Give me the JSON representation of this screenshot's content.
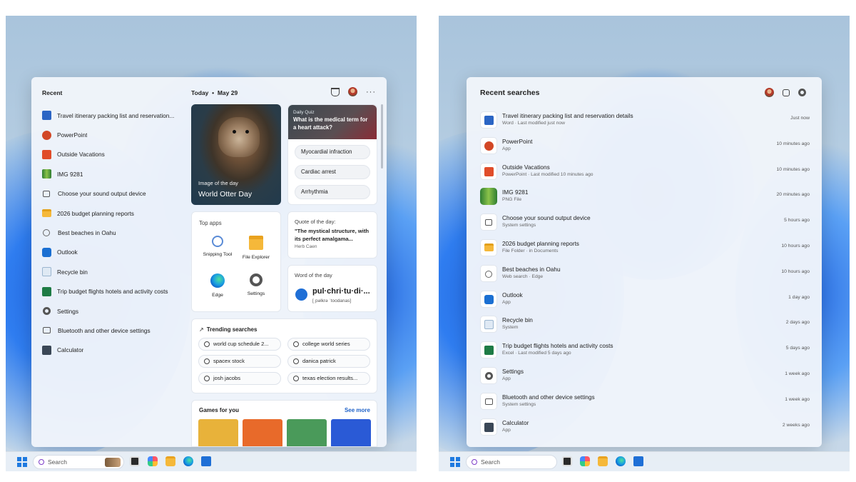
{
  "left": {
    "recent_title": "Recent",
    "recent": [
      {
        "label": "Travel itinerary packing list and reservation...",
        "icon": "word-icon"
      },
      {
        "label": "PowerPoint",
        "icon": "powerpoint-icon"
      },
      {
        "label": "Outside Vacations",
        "icon": "powerpoint-file-icon"
      },
      {
        "label": "IMG 9281",
        "icon": "image-icon"
      },
      {
        "label": "Choose your sound output device",
        "icon": "speaker-icon"
      },
      {
        "label": "2026 budget planning reports",
        "icon": "folder-icon"
      },
      {
        "label": "Best beaches in Oahu",
        "icon": "search-icon"
      },
      {
        "label": "Outlook",
        "icon": "outlook-icon"
      },
      {
        "label": "Recycle bin",
        "icon": "recycle-bin-icon"
      },
      {
        "label": "Trip budget flights hotels and activity costs",
        "icon": "excel-icon"
      },
      {
        "label": "Settings",
        "icon": "gear-icon"
      },
      {
        "label": "Bluetooth and other device settings",
        "icon": "bluetooth-icon"
      },
      {
        "label": "Calculator",
        "icon": "calculator-icon"
      }
    ],
    "today_label": "Today",
    "date": "May 29",
    "image_card": {
      "caption": "Image of the day",
      "title": "World Otter Day"
    },
    "quiz": {
      "kicker": "Daily Quiz",
      "question": "What is the medical term for a heart attack?",
      "options": [
        "Myocardial infraction",
        "Cardiac arrest",
        "Arrhythmia"
      ]
    },
    "top_apps": {
      "title": "Top apps",
      "apps": [
        {
          "label": "Snipping Tool",
          "icon": "snipping-tool-icon"
        },
        {
          "label": "File Explorer",
          "icon": "file-explorer-icon"
        },
        {
          "label": "Edge",
          "icon": "edge-icon"
        },
        {
          "label": "Settings",
          "icon": "settings-icon"
        }
      ]
    },
    "quote": {
      "kicker": "Quote of the day:",
      "text": "\"The mystical structure, with its perfect amalgama...",
      "author": "Herb Caen"
    },
    "word": {
      "kicker": "Word of the day",
      "word": "pul·chri·tu·di·...",
      "pron": "[ˌpəlkrə ˈtoodanas]"
    },
    "trending": {
      "title": "Trending searches",
      "items": [
        "world cup schedule 2...",
        "college world series",
        "spacex stock",
        "danica patrick",
        "josh jacobs",
        "texas election results..."
      ]
    },
    "games": {
      "title": "Games for you",
      "see_more": "See more",
      "tiles": [
        "#e8b23a",
        "#e86a2a",
        "#4a9a5a",
        "#2a5ad6"
      ]
    },
    "taskbar_search_placeholder": "Search"
  },
  "right": {
    "title": "Recent searches",
    "items": [
      {
        "name": "Travel itinerary packing list and reservation details",
        "sub": "Word · Last modified just now",
        "time": "Just now",
        "icon": "word-icon"
      },
      {
        "name": "PowerPoint",
        "sub": "App",
        "time": "10 minutes ago",
        "icon": "powerpoint-icon"
      },
      {
        "name": "Outside Vacations",
        "sub": "PowerPoint · Last modified 10 minutes ago",
        "time": "10 minutes ago",
        "icon": "powerpoint-file-icon"
      },
      {
        "name": "IMG 9281",
        "sub": "PNG File",
        "time": "20 minutes ago",
        "icon": "image-icon"
      },
      {
        "name": "Choose your sound output device",
        "sub": "System settings",
        "time": "5 hours ago",
        "icon": "speaker-icon"
      },
      {
        "name": "2026 budget planning reports",
        "sub": "File Folder · in Documents",
        "time": "10 hours ago",
        "icon": "folder-icon"
      },
      {
        "name": "Best beaches in Oahu",
        "sub": "Web search · Edge",
        "time": "10 hours ago",
        "icon": "search-icon"
      },
      {
        "name": "Outlook",
        "sub": "App",
        "time": "1 day ago",
        "icon": "outlook-icon"
      },
      {
        "name": "Recycle bin",
        "sub": "System",
        "time": "2 days ago",
        "icon": "recycle-bin-icon"
      },
      {
        "name": "Trip budget flights hotels and activity costs",
        "sub": "Excel · Last modified 5 days ago",
        "time": "5 days ago",
        "icon": "excel-icon"
      },
      {
        "name": "Settings",
        "sub": "App",
        "time": "1 week ago",
        "icon": "gear-icon"
      },
      {
        "name": "Bluetooth and other device settings",
        "sub": "System settings",
        "time": "1 week ago",
        "icon": "bluetooth-icon"
      },
      {
        "name": "Calculator",
        "sub": "App",
        "time": "2 weeks ago",
        "icon": "calculator-icon"
      }
    ],
    "taskbar_search_placeholder": "Search"
  }
}
